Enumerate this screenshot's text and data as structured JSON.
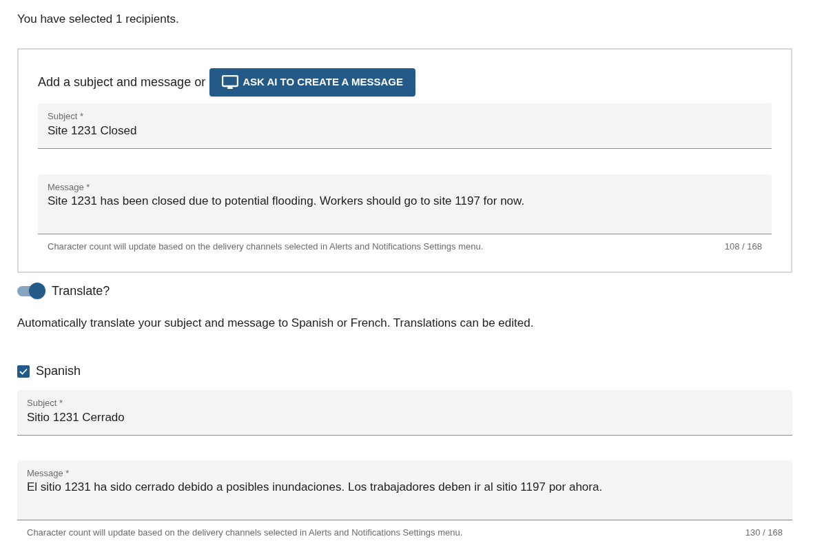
{
  "recipients_note": "You have selected 1 recipients.",
  "compose": {
    "prompt": "Add a subject and message or",
    "ai_button": "ASK AI TO CREATE A MESSAGE",
    "subject": {
      "label": "Subject *",
      "value": "Site 1231 Closed"
    },
    "message": {
      "label": "Message *",
      "value": "Site 1231 has been closed due to potential flooding. Workers should go to site 1197 for now."
    },
    "helper": "Character count will update based on the delivery channels selected in Alerts and Notifications Settings menu.",
    "count": "108 / 168"
  },
  "translate": {
    "label": "Translate?",
    "on": true
  },
  "translate_note": "Automatically translate your subject and message to Spanish or French. Translations can be edited.",
  "languages": [
    {
      "label": "Spanish",
      "checked": true,
      "subject": {
        "label": "Subject *",
        "value": "Sitio 1231 Cerrado"
      },
      "message": {
        "label": "Message *",
        "value": "El sitio 1231 ha sido cerrado debido a posibles inundaciones. Los trabajadores deben ir al sitio 1197 por ahora."
      },
      "helper": "Character count will update based on the delivery channels selected in Alerts and Notifications Settings menu.",
      "count": "130 / 168"
    }
  ]
}
